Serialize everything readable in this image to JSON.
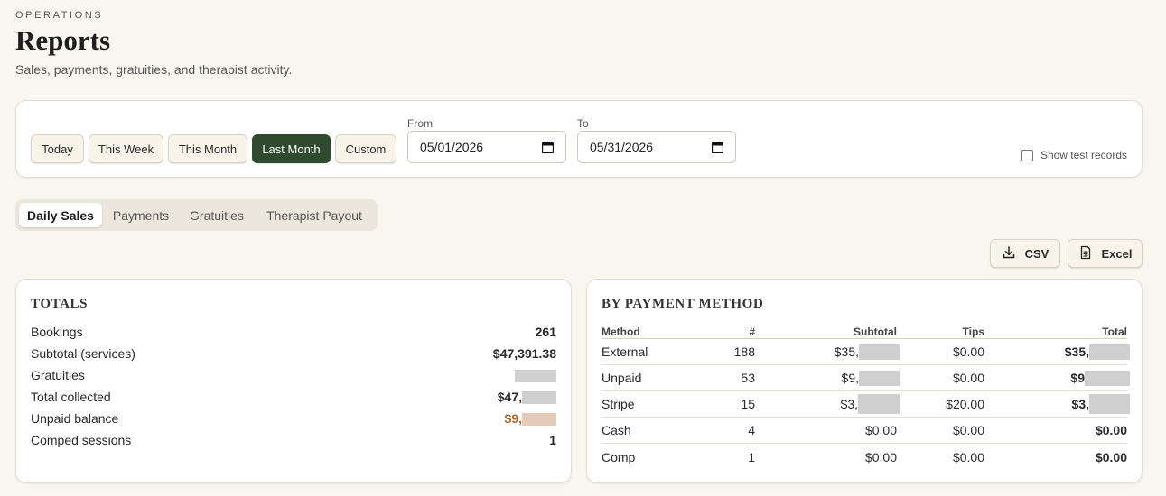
{
  "header": {
    "eyebrow": "OPERATIONS",
    "title": "Reports",
    "subtitle": "Sales, payments, gratuities, and therapist activity."
  },
  "filters": {
    "ranges": [
      {
        "label": "Today",
        "active": false
      },
      {
        "label": "This Week",
        "active": false
      },
      {
        "label": "This Month",
        "active": false
      },
      {
        "label": "Last Month",
        "active": true
      },
      {
        "label": "Custom",
        "active": false
      }
    ],
    "from_label": "From",
    "from_value": "05/01/2026",
    "to_label": "To",
    "to_value": "05/31/2026",
    "show_test_label": "Show test records",
    "show_test_checked": false
  },
  "tabs": [
    {
      "label": "Daily Sales",
      "active": true
    },
    {
      "label": "Payments",
      "active": false
    },
    {
      "label": "Gratuities",
      "active": false
    },
    {
      "label": "Therapist Payout",
      "active": false
    }
  ],
  "export": {
    "csv_label": "CSV",
    "excel_label": "Excel"
  },
  "totals": {
    "title": "TOTALS",
    "rows": [
      {
        "label": "Bookings",
        "value": "261"
      },
      {
        "label": "Subtotal (services)",
        "value": "$47,391.38"
      },
      {
        "label": "Gratuities",
        "value": ""
      },
      {
        "label": "Total collected",
        "value": "$47,"
      },
      {
        "label": "Unpaid balance",
        "value": "$9,"
      },
      {
        "label": "Comped sessions",
        "value": "1"
      }
    ]
  },
  "payment_method": {
    "title": "BY PAYMENT METHOD",
    "columns": [
      "Method",
      "#",
      "Subtotal",
      "Tips",
      "Total"
    ],
    "rows": [
      {
        "method": "External",
        "count": "188",
        "subtotal": "$35,",
        "tips": "$0.00",
        "total": "$35,"
      },
      {
        "method": "Unpaid",
        "count": "53",
        "subtotal": "$9,",
        "tips": "$0.00",
        "total": "$9"
      },
      {
        "method": "Stripe",
        "count": "15",
        "subtotal": "$3,",
        "tips": "$20.00",
        "total": "$3,"
      },
      {
        "method": "Cash",
        "count": "4",
        "subtotal": "$0.00",
        "tips": "$0.00",
        "total": "$0.00"
      },
      {
        "method": "Comp",
        "count": "1",
        "subtotal": "$0.00",
        "tips": "$0.00",
        "total": "$0.00"
      }
    ]
  },
  "colors": {
    "background": "#f9f6ef",
    "accent": "#2f4a2f",
    "warning": "#a4683a"
  },
  "icons": {
    "calendar": "calendar-icon",
    "download": "download-icon",
    "excel": "spreadsheet-icon"
  }
}
